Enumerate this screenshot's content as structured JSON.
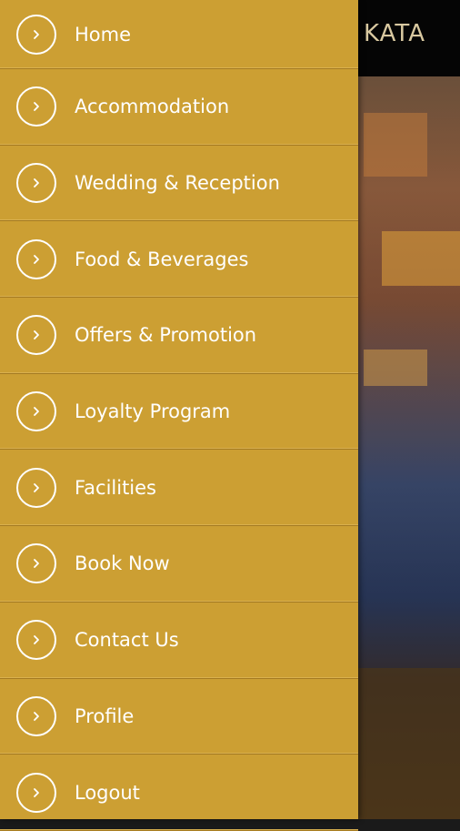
{
  "background": {
    "title": "KATA"
  },
  "drawer": {
    "items": [
      {
        "label": "Home",
        "icon": "chevron-right-icon"
      },
      {
        "label": "Accommodation",
        "icon": "chevron-right-icon"
      },
      {
        "label": "Wedding & Reception",
        "icon": "chevron-right-icon"
      },
      {
        "label": "Food & Beverages",
        "icon": "chevron-right-icon"
      },
      {
        "label": "Offers & Promotion",
        "icon": "chevron-right-icon"
      },
      {
        "label": "Loyalty Program",
        "icon": "chevron-right-icon"
      },
      {
        "label": "Facilities",
        "icon": "chevron-right-icon"
      },
      {
        "label": "Book Now",
        "icon": "chevron-right-icon"
      },
      {
        "label": "Contact Us",
        "icon": "chevron-right-icon"
      },
      {
        "label": "Profile",
        "icon": "chevron-right-icon"
      },
      {
        "label": "Logout",
        "icon": "chevron-right-icon"
      }
    ]
  },
  "colors": {
    "drawer_bg": "#cc9f33",
    "text": "#ffffff",
    "topbar": "#050505"
  }
}
